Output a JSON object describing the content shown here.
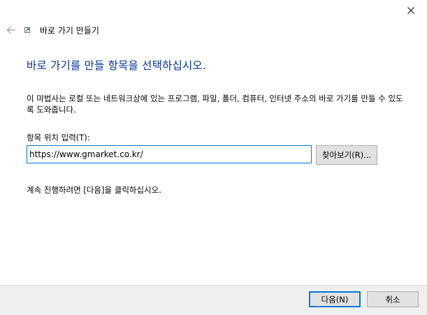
{
  "window": {
    "close_icon": "close-icon",
    "back_icon": "back-arrow-icon",
    "app_icon": "shortcut-icon"
  },
  "wizard": {
    "title": "바로 가기 만들기",
    "main_instruction": "바로 가기를 만들 항목을 선택하십시오.",
    "description": "이 마법사는 로컬 또는 네트워크상에 있는 프로그램, 파일, 폴더, 컴퓨터, 인터넷 주소의 바로 가기를 만들 수 있도록 도와줍니다.",
    "location_label": "항목 위치 입력(T):",
    "location_value": "https://www.gmarket.co.kr/",
    "browse_label": "찾아보기(R)...",
    "continue_text": "계속 진행하려면 [다음]을 클릭하십시오."
  },
  "footer": {
    "next_label": "다음(N)",
    "cancel_label": "취소"
  },
  "colors": {
    "instruction": "#003399",
    "focus_border": "#0078d7",
    "footer_bg": "#f0f0f0",
    "button_bg": "#e1e1e1"
  }
}
